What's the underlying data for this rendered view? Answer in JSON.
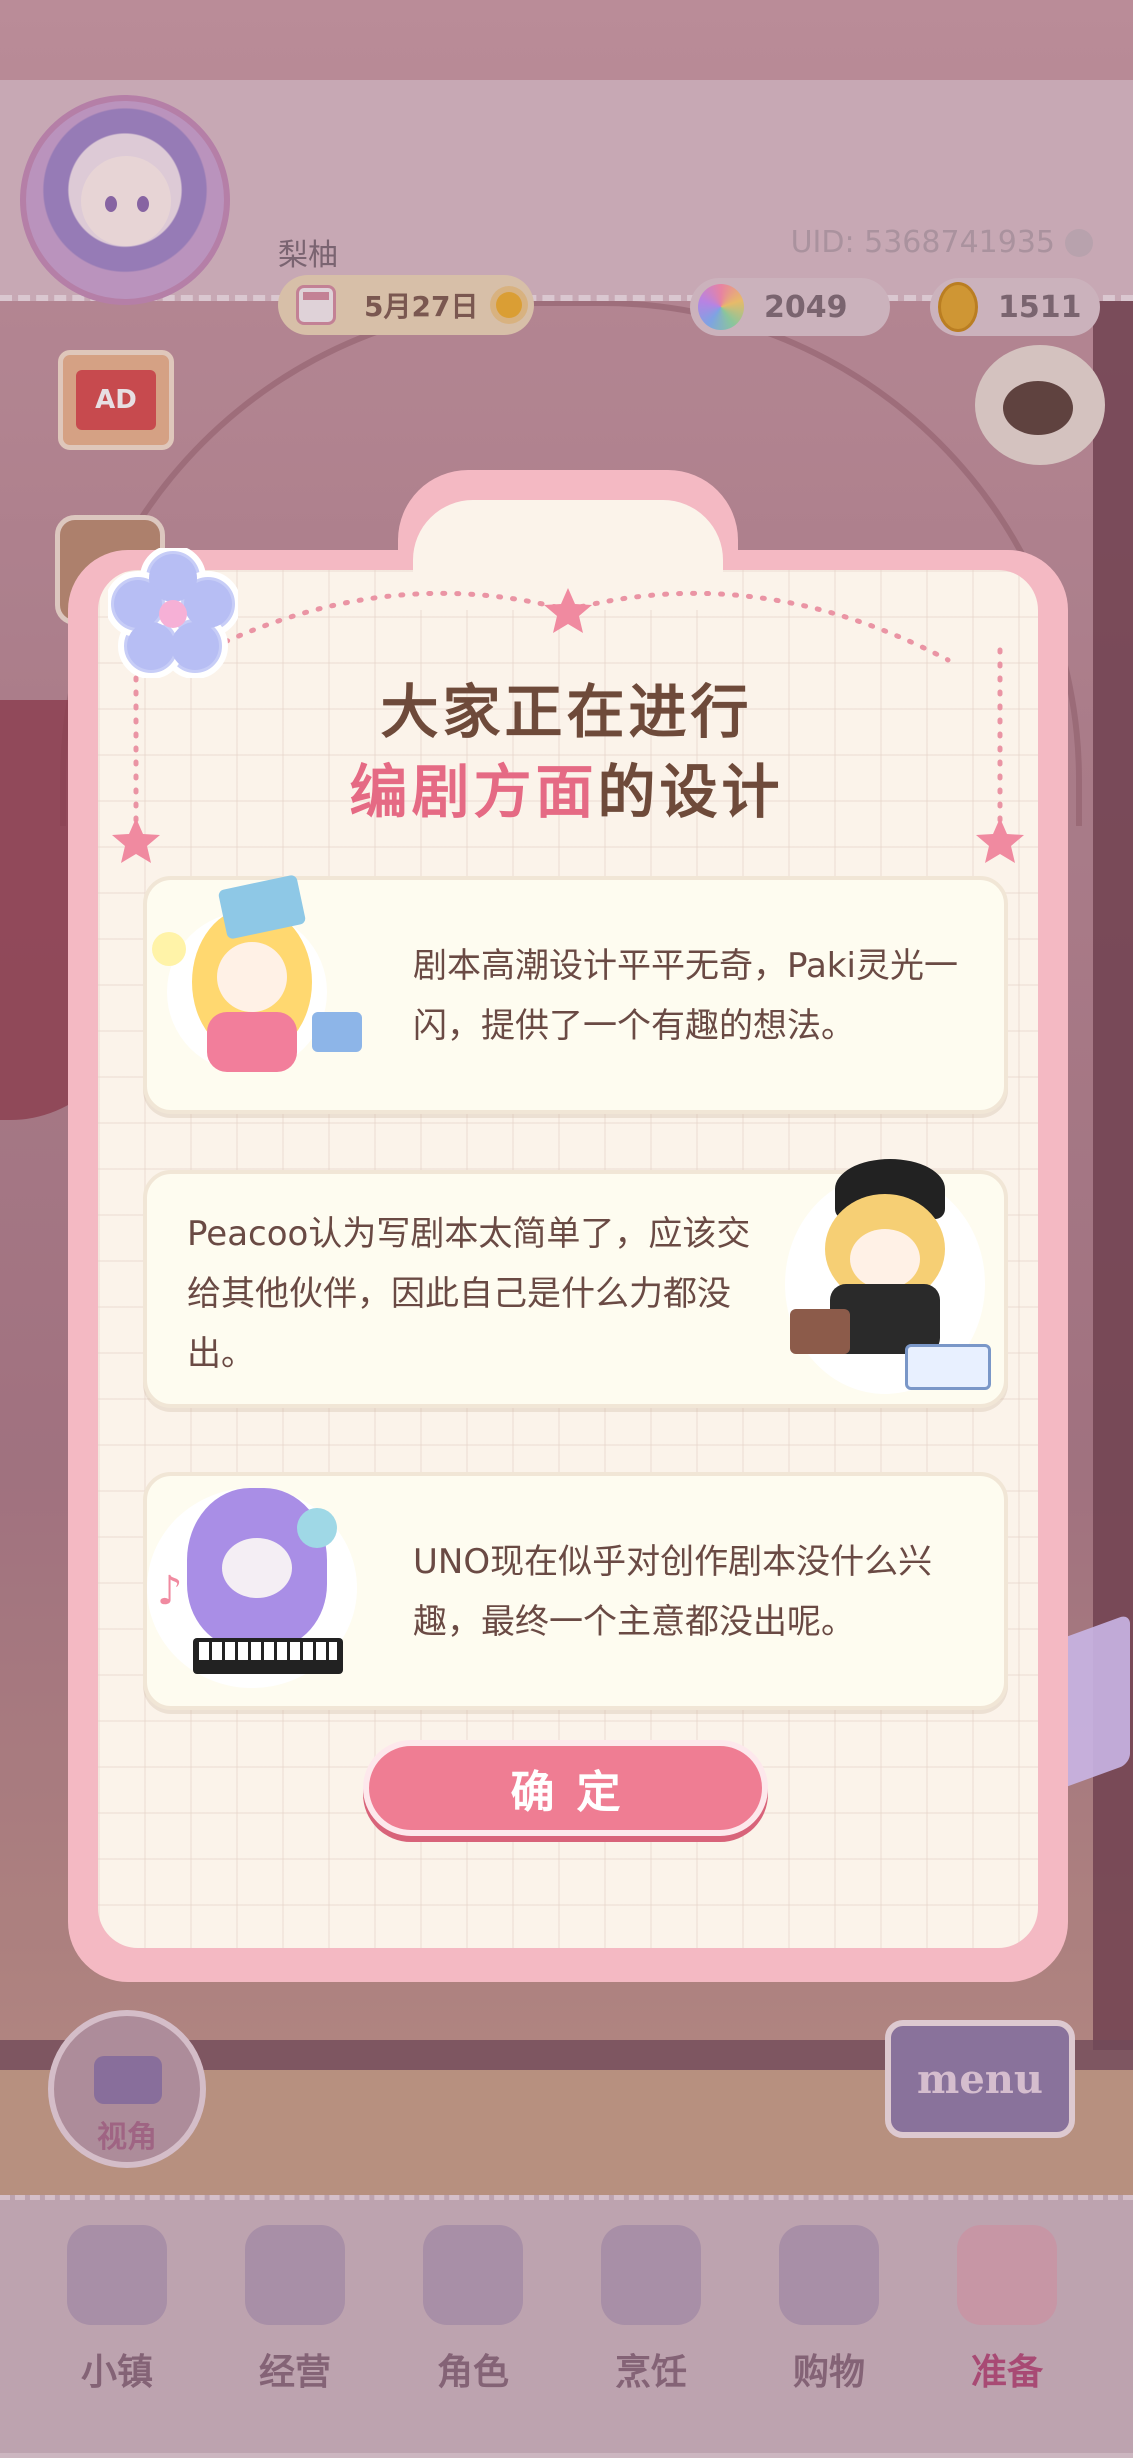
{
  "header": {
    "player_name": "梨柚",
    "date": "5月27日",
    "uid": "UID: 5368741935",
    "gems": "2049",
    "coins": "1511"
  },
  "side": {
    "ad_label": "AD",
    "camera_label": "视角",
    "menu_label": "menu"
  },
  "dialog": {
    "title_line1": "大家正在进行",
    "title_highlight": "编剧方面",
    "title_rest": "的设计",
    "cards": [
      {
        "text": "剧本高潮设计平平无奇，Paki灵光一闪，提供了一个有趣的想法。",
        "character": "paki"
      },
      {
        "text": "Peacoo认为写剧本太简单了，应该交给其他伙伴，因此自己是什么力都没出。",
        "character": "peacoo"
      },
      {
        "text": "UNO现在似乎对创作剧本没什么兴趣，最终一个主意都没出呢。",
        "character": "uno"
      }
    ],
    "confirm_label": "确定"
  },
  "nav": {
    "items": [
      {
        "label": "小镇",
        "icon": "map-icon"
      },
      {
        "label": "经营",
        "icon": "bag-icon"
      },
      {
        "label": "角色",
        "icon": "character-icon"
      },
      {
        "label": "烹饪",
        "icon": "sandwich-icon"
      },
      {
        "label": "购物",
        "icon": "shopping-bag-icon"
      },
      {
        "label": "准备",
        "icon": "hat-icon",
        "active": true
      }
    ]
  },
  "colors": {
    "accent_pink": "#ef7d93",
    "title_brown": "#6e4a3a",
    "highlight_pink": "#e56a84",
    "dialog_frame": "#f4b9c3"
  }
}
